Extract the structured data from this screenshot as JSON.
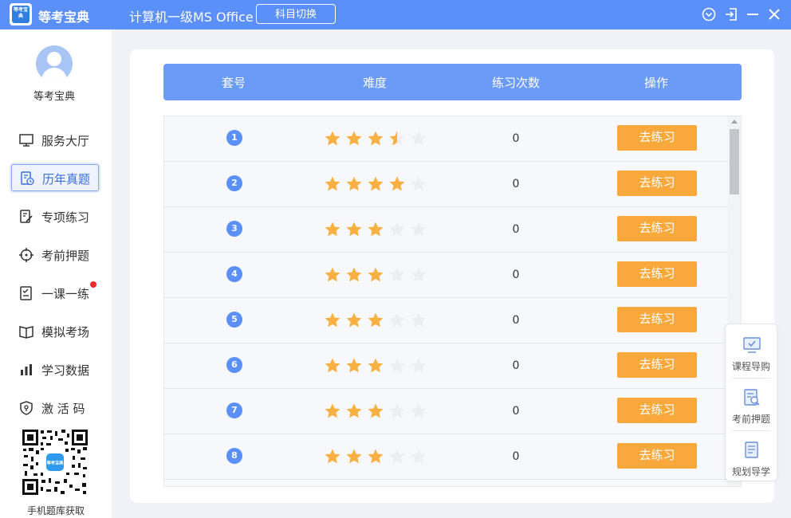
{
  "app": {
    "logo_text": "等考宝典",
    "name": "等考宝典",
    "subject": "计算机一级MS Office",
    "switch_label": "科目切换",
    "brand_color": "#5b8ff9"
  },
  "window_controls": [
    "chevron-down-circle-icon",
    "exit-icon",
    "minimize-icon",
    "close-icon"
  ],
  "sidebar": {
    "user_name": "等考宝典",
    "items": [
      {
        "label": "服务大厅",
        "icon": "monitor-icon",
        "active": false,
        "badge": false
      },
      {
        "label": "历年真题",
        "icon": "document-clock-icon",
        "active": true,
        "badge": false
      },
      {
        "label": "专项练习",
        "icon": "edit-document-icon",
        "active": false,
        "badge": false
      },
      {
        "label": "考前押题",
        "icon": "crosshair-icon",
        "active": false,
        "badge": false
      },
      {
        "label": "一课一练",
        "icon": "checklist-icon",
        "active": false,
        "badge": true
      },
      {
        "label": "模拟考场",
        "icon": "book-icon",
        "active": false,
        "badge": false
      },
      {
        "label": "学习数据",
        "icon": "bar-chart-icon",
        "active": false,
        "badge": false
      },
      {
        "label": "激 活 码",
        "icon": "shield-icon",
        "active": false,
        "badge": false
      }
    ],
    "qr_center_text": "等考宝典",
    "qr_caption": "手机题库获取"
  },
  "table": {
    "headers": [
      "套号",
      "难度",
      "练习次数",
      "操作"
    ],
    "rows": [
      {
        "num": "1",
        "stars": 3.5,
        "count": "0",
        "action": "去练习"
      },
      {
        "num": "2",
        "stars": 4,
        "count": "0",
        "action": "去练习"
      },
      {
        "num": "3",
        "stars": 3,
        "count": "0",
        "action": "去练习"
      },
      {
        "num": "4",
        "stars": 3,
        "count": "0",
        "action": "去练习"
      },
      {
        "num": "5",
        "stars": 3,
        "count": "0",
        "action": "去练习"
      },
      {
        "num": "6",
        "stars": 3,
        "count": "0",
        "action": "去练习"
      },
      {
        "num": "7",
        "stars": 3,
        "count": "0",
        "action": "去练习"
      },
      {
        "num": "8",
        "stars": 3,
        "count": "0",
        "action": "去练习"
      }
    ],
    "star_color": "#f9b043",
    "star_empty_color": "#eceef2",
    "button_color": "#f9a93b"
  },
  "float_panel": {
    "items": [
      {
        "label": "课程导购",
        "icon": "monitor-check-icon"
      },
      {
        "label": "考前押题",
        "icon": "document-search-icon"
      },
      {
        "label": "规划导学",
        "icon": "document-list-icon"
      }
    ]
  }
}
